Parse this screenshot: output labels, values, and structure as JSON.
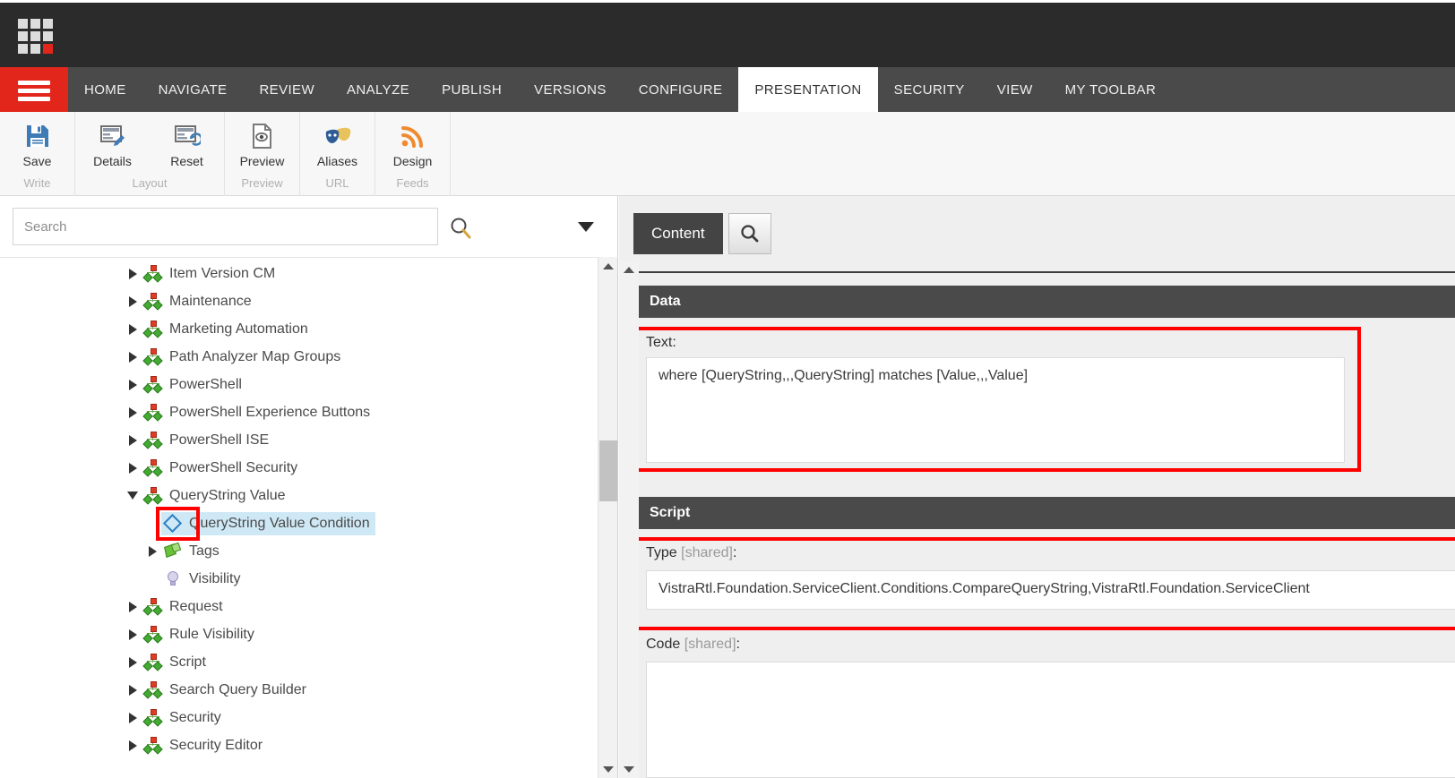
{
  "app": {
    "logo_name": "sitecore-logo",
    "accent_color": "#e3261c"
  },
  "ribbon": {
    "menu_button_name": "hamburger-menu",
    "tabs": [
      {
        "label": "HOME",
        "active": false
      },
      {
        "label": "NAVIGATE",
        "active": false
      },
      {
        "label": "REVIEW",
        "active": false
      },
      {
        "label": "ANALYZE",
        "active": false
      },
      {
        "label": "PUBLISH",
        "active": false
      },
      {
        "label": "VERSIONS",
        "active": false
      },
      {
        "label": "CONFIGURE",
        "active": false
      },
      {
        "label": "PRESENTATION",
        "active": true
      },
      {
        "label": "SECURITY",
        "active": false
      },
      {
        "label": "VIEW",
        "active": false
      },
      {
        "label": "MY TOOLBAR",
        "active": false
      }
    ],
    "groups": [
      {
        "name": "Write",
        "buttons": [
          {
            "label": "Save",
            "icon": "save-icon"
          }
        ]
      },
      {
        "name": "Layout",
        "buttons": [
          {
            "label": "Details",
            "icon": "details-icon"
          },
          {
            "label": "Reset",
            "icon": "reset-icon"
          }
        ]
      },
      {
        "name": "Preview",
        "buttons": [
          {
            "label": "Preview",
            "icon": "preview-icon"
          }
        ]
      },
      {
        "name": "URL",
        "buttons": [
          {
            "label": "Aliases",
            "icon": "aliases-masks-icon"
          }
        ]
      },
      {
        "name": "Feeds",
        "buttons": [
          {
            "label": "Design",
            "icon": "rss-feed-icon"
          }
        ]
      }
    ]
  },
  "left_pane": {
    "search": {
      "placeholder": "Search",
      "value": "",
      "icon": "search-icon",
      "caret_icon": "chevron-down-icon"
    },
    "tree": [
      {
        "label": "Item Version CM",
        "icon": "node-icon",
        "indent": 0,
        "twist": "right",
        "selected": false
      },
      {
        "label": "Maintenance",
        "icon": "node-icon",
        "indent": 0,
        "twist": "right",
        "selected": false
      },
      {
        "label": "Marketing Automation",
        "icon": "node-icon",
        "indent": 0,
        "twist": "right",
        "selected": false
      },
      {
        "label": "Path Analyzer Map Groups",
        "icon": "node-icon",
        "indent": 0,
        "twist": "right",
        "selected": false
      },
      {
        "label": "PowerShell",
        "icon": "node-icon",
        "indent": 0,
        "twist": "right",
        "selected": false
      },
      {
        "label": "PowerShell Experience Buttons",
        "icon": "node-icon",
        "indent": 0,
        "twist": "right",
        "selected": false
      },
      {
        "label": "PowerShell ISE",
        "icon": "node-icon",
        "indent": 0,
        "twist": "right",
        "selected": false
      },
      {
        "label": "PowerShell Security",
        "icon": "node-icon",
        "indent": 0,
        "twist": "right",
        "selected": false
      },
      {
        "label": "QueryString Value",
        "icon": "node-icon",
        "indent": 0,
        "twist": "down",
        "selected": false
      },
      {
        "label": "QueryString Value Condition",
        "icon": "diamond-condition-icon",
        "indent": 1,
        "twist": "none",
        "selected": true
      },
      {
        "label": "Tags",
        "icon": "tags-icon",
        "indent": 1,
        "twist": "right",
        "selected": false
      },
      {
        "label": "Visibility",
        "icon": "bulb-icon",
        "indent": 1,
        "twist": "none",
        "selected": false
      },
      {
        "label": "Request",
        "icon": "node-icon",
        "indent": 0,
        "twist": "right",
        "selected": false
      },
      {
        "label": "Rule Visibility",
        "icon": "node-icon",
        "indent": 0,
        "twist": "right",
        "selected": false
      },
      {
        "label": "Script",
        "icon": "node-icon",
        "indent": 0,
        "twist": "right",
        "selected": false
      },
      {
        "label": "Search Query Builder",
        "icon": "node-icon",
        "indent": 0,
        "twist": "right",
        "selected": false
      },
      {
        "label": "Security",
        "icon": "node-icon",
        "indent": 0,
        "twist": "right",
        "selected": false
      },
      {
        "label": "Security Editor",
        "icon": "node-icon",
        "indent": 0,
        "twist": "right",
        "selected": false
      }
    ],
    "scrollbar": {
      "up_icon": "scroll-up-arrow",
      "down_icon": "scroll-down-arrow"
    }
  },
  "right_pane": {
    "tabs": [
      {
        "label": "Content",
        "active": true
      }
    ],
    "search_tab_icon": "search-icon",
    "sections": [
      {
        "title": "Data",
        "fields": [
          {
            "label": "Text:",
            "shared": "",
            "value": "where [QueryString,,,QueryString] matches [Value,,,Value]",
            "highlighted": true
          }
        ]
      },
      {
        "title": "Script",
        "fields": [
          {
            "label": "Type ",
            "shared": "[shared]",
            "suffix": ":",
            "value": "VistraRtl.Foundation.ServiceClient.Conditions.CompareQueryString,VistraRtl.Foundation.ServiceClient",
            "highlighted": true
          },
          {
            "label": "Code ",
            "shared": "[shared]",
            "suffix": ":",
            "value": "",
            "highlighted": false
          }
        ]
      }
    ],
    "scrollbar": {
      "up_icon": "scroll-up-arrow",
      "down_icon": "scroll-down-arrow"
    }
  }
}
